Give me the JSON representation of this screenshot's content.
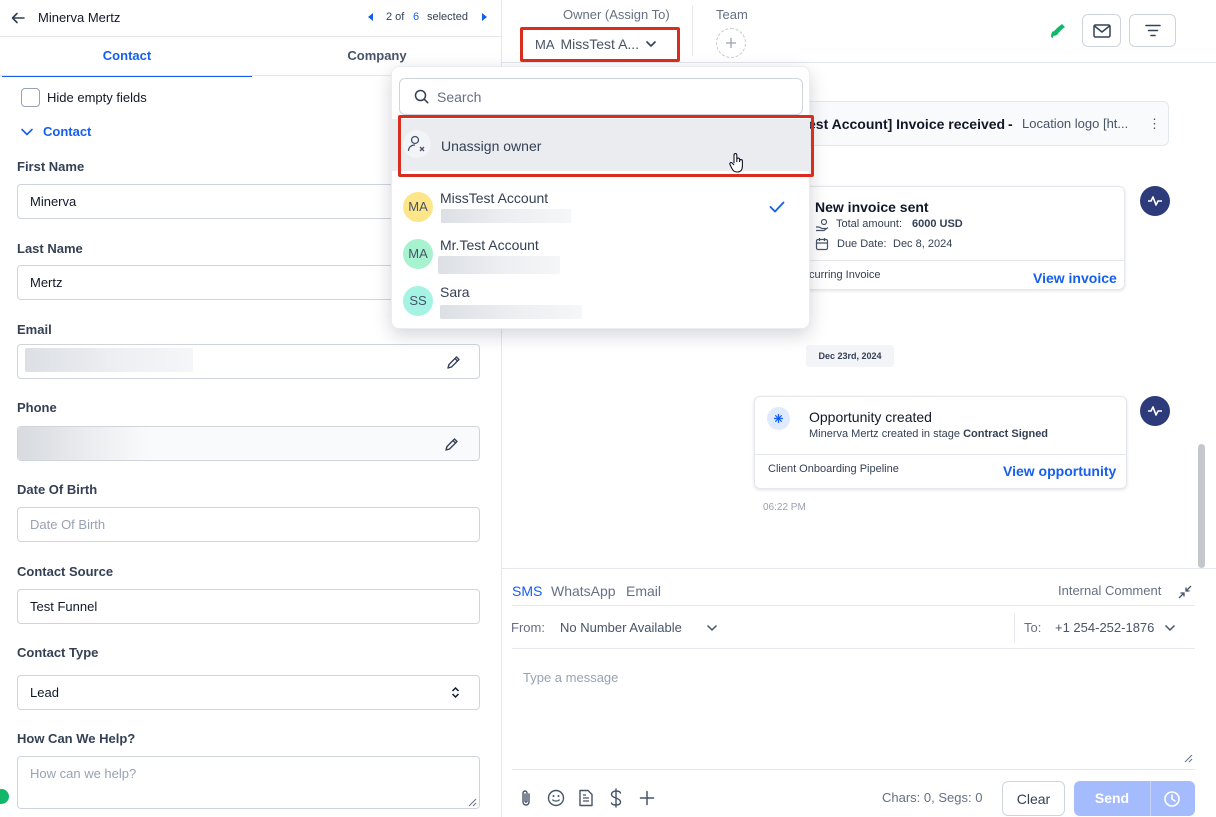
{
  "header": {
    "contact_name": "Minerva Mertz",
    "pager_current": "2 of",
    "pager_total": "6",
    "pager_suffix": "selected"
  },
  "tabs": [
    {
      "label": "Contact"
    },
    {
      "label": "Company"
    }
  ],
  "hide_empty": {
    "label": "Hide empty fields",
    "checked": false
  },
  "section_title": "Contact",
  "fields": {
    "first_name": {
      "label": "First Name",
      "value": "Minerva"
    },
    "last_name": {
      "label": "Last Name",
      "value": "Mertz"
    },
    "email": {
      "label": "Email"
    },
    "phone": {
      "label": "Phone"
    },
    "dob": {
      "label": "Date Of Birth",
      "placeholder": "Date Of Birth"
    },
    "source": {
      "label": "Contact Source",
      "value": "Test Funnel"
    },
    "type": {
      "label": "Contact Type",
      "value": "Lead"
    },
    "help": {
      "label": "How Can We Help?",
      "placeholder": "How can we help?"
    }
  },
  "topbar": {
    "owner_label": "Owner (Assign To)",
    "owner_initials": "MA",
    "owner_name": "MissTest A...",
    "team_label": "Team"
  },
  "dropdown": {
    "search_placeholder": "Search",
    "unassign_label": "Unassign owner",
    "users": [
      {
        "initials": "MA",
        "name": "MissTest Account",
        "selected": true,
        "color": "#fde68a"
      },
      {
        "initials": "MA",
        "name": "Mr.Test Account",
        "selected": false,
        "color": "#a7f3d0"
      },
      {
        "initials": "SS",
        "name": "Sara",
        "selected": false,
        "color": "#a5f3e3"
      }
    ]
  },
  "feed": {
    "email_item": {
      "title": "est Account] Invoice received",
      "sep": "-",
      "preview": "Location logo [ht..."
    },
    "invoice": {
      "title": "New invoice sent",
      "amount_label": "Total amount:",
      "amount_value": "6000 USD",
      "due_label": "Due Date:",
      "due_value": "Dec 8, 2024",
      "footer": "curring Invoice",
      "link": "View invoice"
    },
    "date_chip": "Dec 23rd, 2024",
    "opportunity": {
      "title": "Opportunity created",
      "desc_prefix": "Minerva Mertz created in stage",
      "stage": "Contract Signed",
      "pipeline": "Client Onboarding Pipeline",
      "link": "View opportunity"
    },
    "time": "06:22 PM"
  },
  "composer": {
    "tabs": [
      "SMS",
      "WhatsApp",
      "Email"
    ],
    "active_tab": "SMS",
    "internal_comment": "Internal Comment",
    "from_label": "From:",
    "from_value": "No Number Available",
    "to_label": "To:",
    "to_value": "+1 254-252-1876",
    "placeholder": "Type a message",
    "counter": "Chars: 0, Segs: 0",
    "clear": "Clear",
    "send": "Send"
  },
  "colors": {
    "accent": "#155eef",
    "highlight": "#d92d20",
    "activity": "#2e3b7a",
    "send_disabled": "#a4bcfd"
  }
}
